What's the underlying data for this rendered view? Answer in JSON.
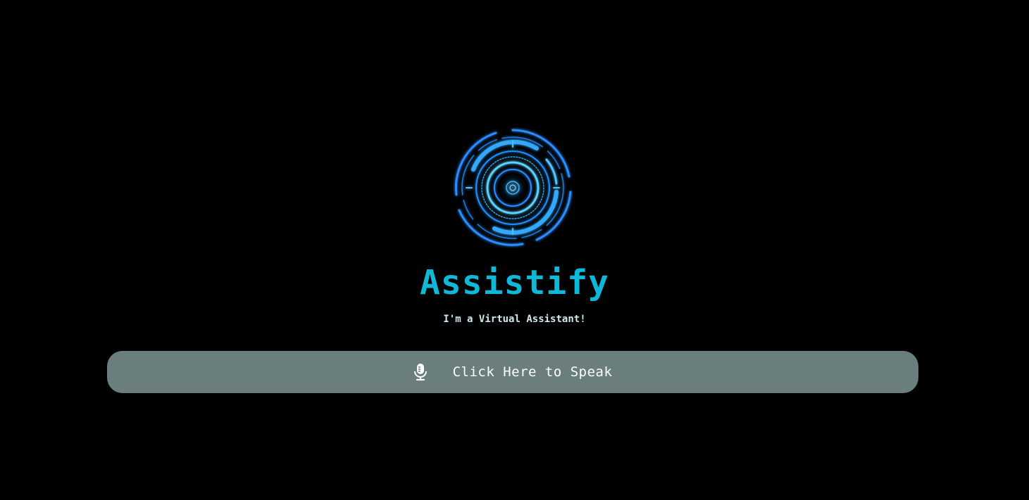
{
  "app": {
    "title": "Assistify",
    "subtitle": "I'm a Virtual Assistant!"
  },
  "logo": {
    "icon": "circular-hud-eye-icon",
    "accent_color": "#1e9bff"
  },
  "speak_button": {
    "label": "Click Here to Speak",
    "icon": "microphone-icon",
    "background": "#6a7e7e"
  },
  "colors": {
    "background": "#000000",
    "title": "#0fb8d6",
    "subtitle": "#cfe8ee"
  }
}
